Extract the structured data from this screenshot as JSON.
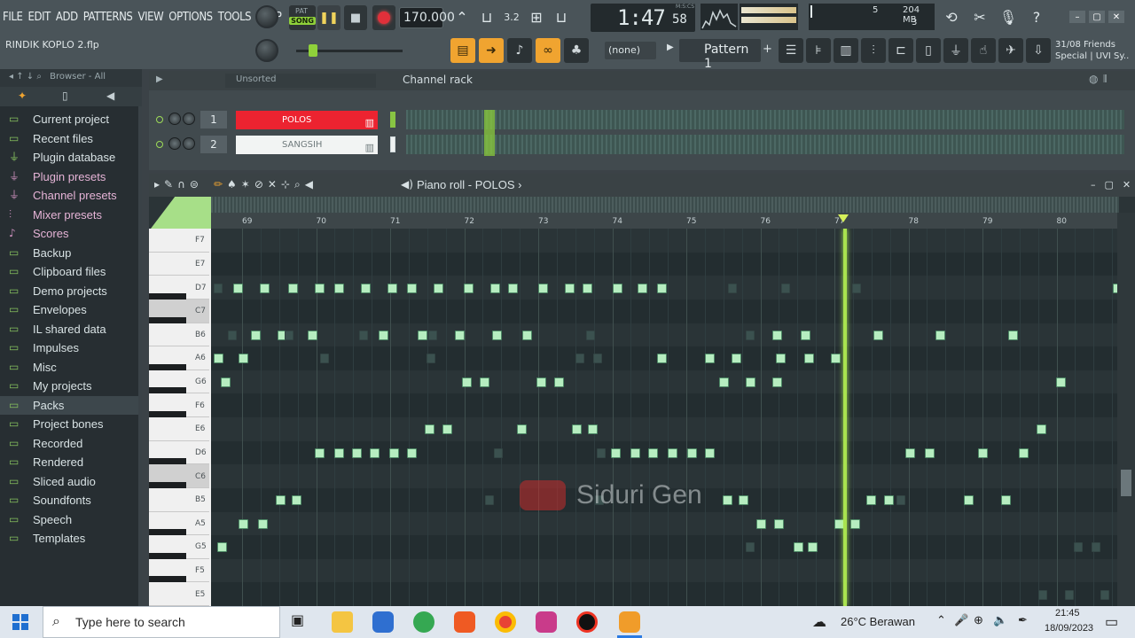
{
  "menu": [
    "FILE",
    "EDIT",
    "ADD",
    "PATTERNS",
    "VIEW",
    "OPTIONS",
    "TOOLS",
    "HELP"
  ],
  "project": {
    "filename": "RINDIK KOPLO 2.flp"
  },
  "transport": {
    "song_mode_label": "SONG",
    "pat_label": "PAT",
    "tempo": "170.000",
    "time_main": "1:47",
    "time_sub": "58",
    "time_label": "M:S:CS"
  },
  "cpu": {
    "value": "5",
    "memory": "204 MB",
    "polyphony": "3"
  },
  "toolbar2": {
    "snap": "(none)",
    "pattern": "Pattern 1"
  },
  "news": {
    "line1": "31/08  Friends",
    "line2": "Special | UVI Sy.."
  },
  "browser": {
    "header": "Browser - All",
    "items": [
      {
        "label": "Current project",
        "icon": "folder-icon",
        "style": "normal"
      },
      {
        "label": "Recent files",
        "icon": "folder-icon",
        "style": "normal"
      },
      {
        "label": "Plugin database",
        "icon": "plug-icon",
        "style": "normal"
      },
      {
        "label": "Plugin presets",
        "icon": "plug-icon",
        "style": "pink"
      },
      {
        "label": "Channel presets",
        "icon": "plug-icon",
        "style": "pink"
      },
      {
        "label": "Mixer presets",
        "icon": "mixer-icon",
        "style": "pink"
      },
      {
        "label": "Scores",
        "icon": "note-icon",
        "style": "pink"
      },
      {
        "label": "Backup",
        "icon": "folder-icon",
        "style": "normal"
      },
      {
        "label": "Clipboard files",
        "icon": "folder-icon",
        "style": "normal"
      },
      {
        "label": "Demo projects",
        "icon": "folder-icon",
        "style": "normal"
      },
      {
        "label": "Envelopes",
        "icon": "folder-icon",
        "style": "normal"
      },
      {
        "label": "IL shared data",
        "icon": "folder-icon",
        "style": "normal"
      },
      {
        "label": "Impulses",
        "icon": "folder-icon",
        "style": "normal"
      },
      {
        "label": "Misc",
        "icon": "folder-icon",
        "style": "normal"
      },
      {
        "label": "My projects",
        "icon": "folder-icon",
        "style": "normal"
      },
      {
        "label": "Packs",
        "icon": "folder-icon",
        "style": "selected"
      },
      {
        "label": "Project bones",
        "icon": "folder-icon",
        "style": "normal"
      },
      {
        "label": "Recorded",
        "icon": "folder-icon",
        "style": "normal"
      },
      {
        "label": "Rendered",
        "icon": "folder-icon",
        "style": "normal"
      },
      {
        "label": "Sliced audio",
        "icon": "folder-icon",
        "style": "normal"
      },
      {
        "label": "Soundfonts",
        "icon": "folder-icon",
        "style": "normal"
      },
      {
        "label": "Speech",
        "icon": "folder-icon",
        "style": "normal"
      },
      {
        "label": "Templates",
        "icon": "folder-icon",
        "style": "normal"
      }
    ]
  },
  "channel_rack": {
    "title": "Channel rack",
    "filter": "Unsorted",
    "channels": [
      {
        "number": "1",
        "name": "POLOS",
        "color": "#ec2330"
      },
      {
        "number": "2",
        "name": "SANGSIH",
        "color": "#f2f4f3"
      }
    ]
  },
  "piano_roll": {
    "title": "Piano roll - POLOS",
    "bars": [
      "69",
      "70",
      "71",
      "72",
      "73",
      "74",
      "75",
      "76",
      "77",
      "78",
      "79",
      "80"
    ],
    "keys": [
      "F7",
      "E7",
      "D7",
      "C7",
      "B6",
      "A6",
      "G6",
      "F6",
      "E6",
      "D6",
      "C6",
      "B5",
      "A5",
      "G5",
      "F5",
      "E5"
    ],
    "playhead_bar": "77"
  },
  "watermark": "Siduri Gen",
  "taskbar": {
    "search_placeholder": "Type here to search",
    "weather": "26°C  Berawan",
    "time": "21:45",
    "date": "18/09/2023"
  }
}
